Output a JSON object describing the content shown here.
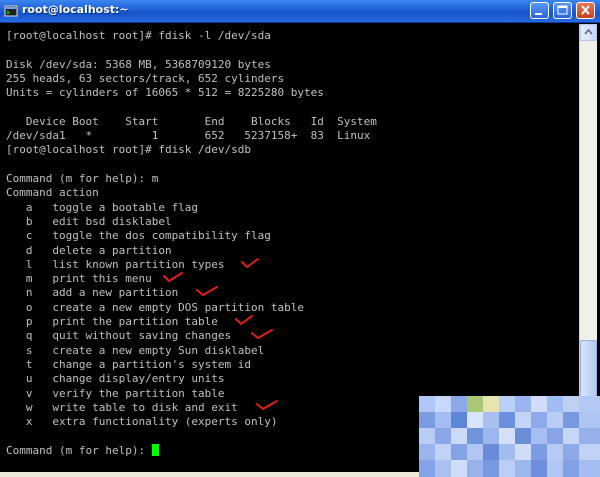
{
  "window": {
    "title": "root@localhost:~",
    "colors": {
      "titlebar": "#1f5fd6",
      "terminal_bg": "#000000",
      "terminal_fg": "#c0c0c0",
      "cursor": "#00ff00",
      "check": "#e0201c"
    }
  },
  "terminal": {
    "lines": [
      "[root@localhost root]# fdisk -l /dev/sda",
      "",
      "Disk /dev/sda: 5368 MB, 5368709120 bytes",
      "255 heads, 63 sectors/track, 652 cylinders",
      "Units = cylinders of 16065 * 512 = 8225280 bytes",
      "",
      "   Device Boot    Start       End    Blocks   Id  System",
      "/dev/sda1   *         1       652   5237158+  83  Linux",
      "[root@localhost root]# fdisk /dev/sdb",
      "",
      "Command (m for help): m",
      "Command action",
      "   a   toggle a bootable flag",
      "   b   edit bsd disklabel",
      "   c   toggle the dos compatibility flag",
      "   d   delete a partition",
      "   l   list known partition types",
      "   m   print this menu",
      "   n   add a new partition",
      "   o   create a new empty DOS partition table",
      "   p   print the partition table",
      "   q   quit without saving changes",
      "   s   create a new empty Sun disklabel",
      "   t   change a partition's system id",
      "   u   change display/entry units",
      "   v   verify the partition table",
      "   w   write table to disk and exit",
      "   x   extra functionality (experts only)",
      "",
      "Command (m for help): "
    ]
  }
}
